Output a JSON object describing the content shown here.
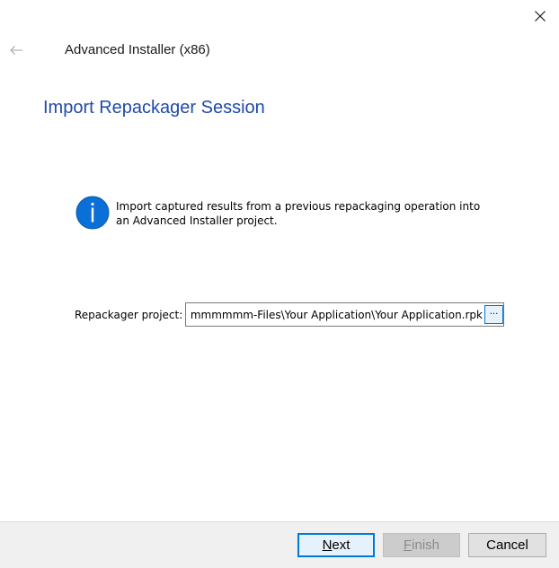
{
  "window": {
    "title": "Advanced Installer (x86)",
    "close_icon": "close-icon",
    "back_icon": "back-arrow-icon"
  },
  "page": {
    "title": "Import Repackager Session",
    "title_color": "#1f4aa8"
  },
  "info": {
    "icon": "info-icon",
    "icon_color": "#0078d7",
    "text": "Import captured results from a previous repackaging operation into an Advanced Installer project."
  },
  "form": {
    "project_label": "Repackager project:",
    "project_value": "C:\\Users\\mmmmmmmmmmmmmmmmmmmmmmmm-Files\\Your Application\\Your Application.rpk",
    "browse_label": "..."
  },
  "buttons": {
    "next_mnemonic": "N",
    "next_rest": "ext",
    "finish_mnemonic": "F",
    "finish_rest": "inish",
    "cancel_label": "Cancel"
  }
}
